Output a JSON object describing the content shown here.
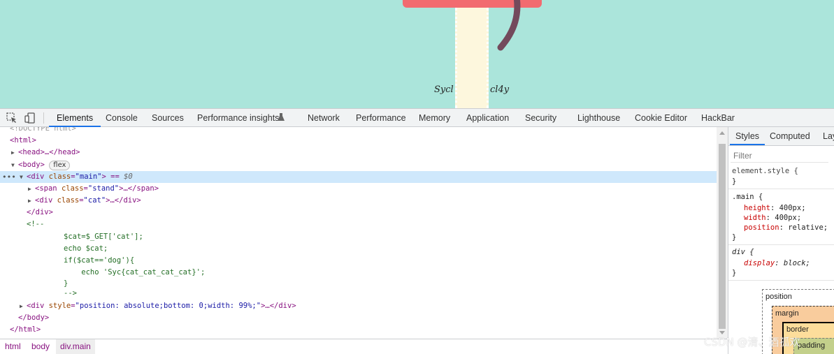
{
  "preview": {
    "signature_left": "Sycl",
    "signature_right": "cl4y"
  },
  "devtools": {
    "tabs": [
      "Elements",
      "Console",
      "Sources",
      "Performance insights",
      "Network",
      "Performance",
      "Memory",
      "Application",
      "Security",
      "Lighthouse",
      "Cookie Editor",
      "HackBar"
    ],
    "active_tab": "Elements"
  },
  "dom": {
    "doctype": "<!DOCTYPE html>",
    "html_open": "<html>",
    "head": "<head>…</head>",
    "body_open": "<body>",
    "body_badge": "flex",
    "div_main_open": "<div ",
    "div_main_attr_name": "class",
    "div_main_attr_value": "\"main\"",
    "div_main_tail": "> == ",
    "dollar": "$0",
    "span_stand_open": "<span ",
    "span_stand_attr": "class",
    "span_stand_val": "\"stand\"",
    "span_stand_tail": ">…</span>",
    "div_cat_open": "<div ",
    "div_cat_attr": "class",
    "div_cat_val": "\"cat\"",
    "div_cat_tail": ">…</div>",
    "div_close": "</div>",
    "comment_open": "<!--",
    "comment_lines": [
      "$cat=$_GET['cat'];",
      "echo $cat;",
      "if($cat=='dog'){",
      "    echo 'Syc{cat_cat_cat_cat}';",
      "}",
      "-->"
    ],
    "div_style_open": "<div ",
    "div_style_attr": "style",
    "div_style_val": "\"position: absolute;bottom: 0;width: 99%;\"",
    "div_style_tail": ">…</div>",
    "body_close": "</body>",
    "html_close": "</html>"
  },
  "breadcrumbs": [
    "html",
    "body",
    "div.main"
  ],
  "styles_pane": {
    "tabs": [
      "Styles",
      "Computed",
      "Lay"
    ],
    "filter_placeholder": "Filter",
    "element_style": "element.style {",
    "close_brace": "}",
    "main_selector": ".main {",
    "main_props": [
      {
        "name": "height",
        "value": "400px;"
      },
      {
        "name": "width",
        "value": "400px;"
      },
      {
        "name": "position",
        "value": "relative;"
      }
    ],
    "ua_selector": "div {",
    "ua_prop": {
      "name": "display",
      "value": "block;"
    },
    "box_model": {
      "position": "position",
      "margin": "margin",
      "border": "border",
      "padding": "padding"
    }
  },
  "watermark": "CSDN @清、酒孤欢"
}
